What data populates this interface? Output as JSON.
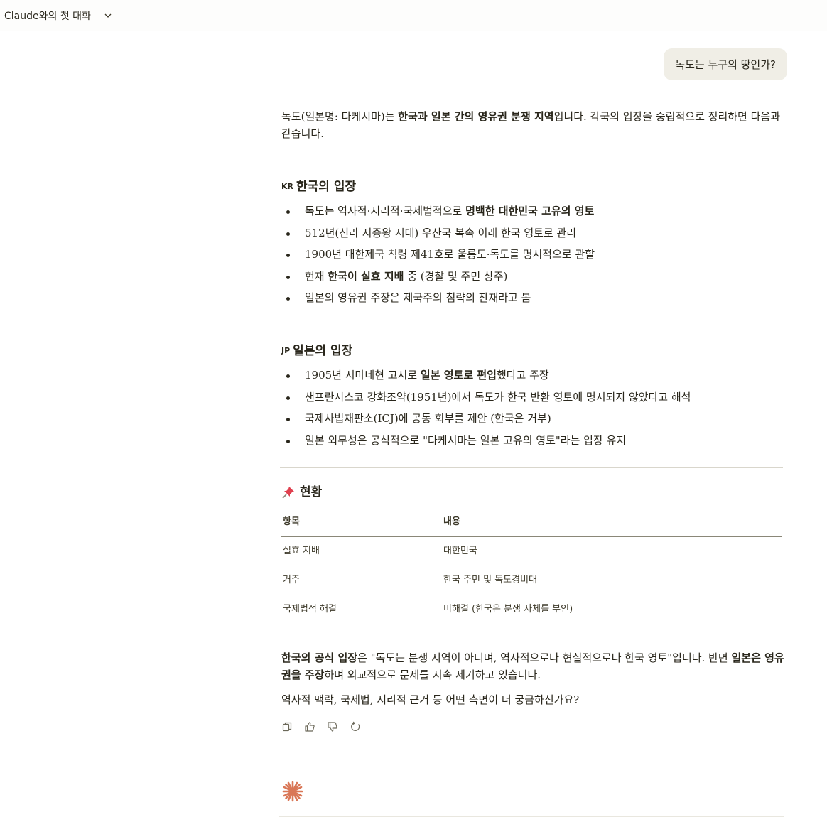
{
  "header": {
    "title": "Claude와의 첫 대화"
  },
  "user_message": "독도는 누구의 땅인가?",
  "response": {
    "intro": [
      {
        "t": "독도(일본명: 다케시마)는 "
      },
      {
        "t": "한국과 일본 간의 영유권 분쟁 지역",
        "b": true
      },
      {
        "t": "입니다. 각국의 입장을 중립적으로 정리하면 다음과 같습니다."
      }
    ],
    "korea": {
      "flag": "KR",
      "heading": "한국의 입장",
      "items": [
        [
          {
            "t": "독도는 역사적·지리적·국제법적으로 "
          },
          {
            "t": "명백한 대한민국 고유의 영토",
            "b": true
          }
        ],
        [
          {
            "t": "512년(신라 지증왕 시대) 우산국 복속 이래 한국 영토로 관리"
          }
        ],
        [
          {
            "t": "1900년 대한제국 칙령 제41호로 울릉도·독도를 명시적으로 관할"
          }
        ],
        [
          {
            "t": "현재 "
          },
          {
            "t": "한국이 실효 지배",
            "b": true
          },
          {
            "t": " 중 (경찰 및 주민 상주)"
          }
        ],
        [
          {
            "t": "일본의 영유권 주장은 제국주의 침략의 잔재라고 봄"
          }
        ]
      ]
    },
    "japan": {
      "flag": "JP",
      "heading": "일본의 입장",
      "items": [
        [
          {
            "t": "1905년 시마네현 고시로 "
          },
          {
            "t": "일본 영토로 편입",
            "b": true
          },
          {
            "t": "했다고 주장"
          }
        ],
        [
          {
            "t": "샌프란시스코 강화조약(1951년)에서 독도가 한국 반환 영토에 명시되지 않았다고 해석"
          }
        ],
        [
          {
            "t": "국제사법재판소(ICJ)에 공동 회부를 제안 (한국은 거부)"
          }
        ],
        [
          {
            "t": "일본 외무성은 공식적으로 \"다케시마는 일본 고유의 영토\"라는 입장 유지"
          }
        ]
      ]
    },
    "status": {
      "icon": "pushpin-icon",
      "heading": "현황",
      "columns": [
        "항목",
        "내용"
      ],
      "rows": [
        [
          "실효 지배",
          "대한민국"
        ],
        [
          "거주",
          "한국 주민 및 독도경비대"
        ],
        [
          "국제법적 해결",
          "미해결 (한국은 분쟁 자체를 부인)"
        ]
      ]
    },
    "summary": [
      {
        "t": "한국의 공식 입장",
        "b": true
      },
      {
        "t": "은 \"독도는 분쟁 지역이 아니며, 역사적으로나 현실적으로나 한국 영토\"입니다. 반면 "
      },
      {
        "t": "일본은 영유권을 주장",
        "b": true
      },
      {
        "t": "하며 외교적으로 문제를 지속 제기하고 있습니다."
      }
    ],
    "closing": "역사적 맥락, 국제법, 지리적 근거 등 어떤 측면이 더 궁금하신가요?"
  },
  "actions": [
    "copy-icon",
    "thumbs-up-icon",
    "thumbs-down-icon",
    "retry-icon"
  ],
  "colors": {
    "accent": "#d97757",
    "bubble": "#f0eee6",
    "text": "#29261b"
  }
}
